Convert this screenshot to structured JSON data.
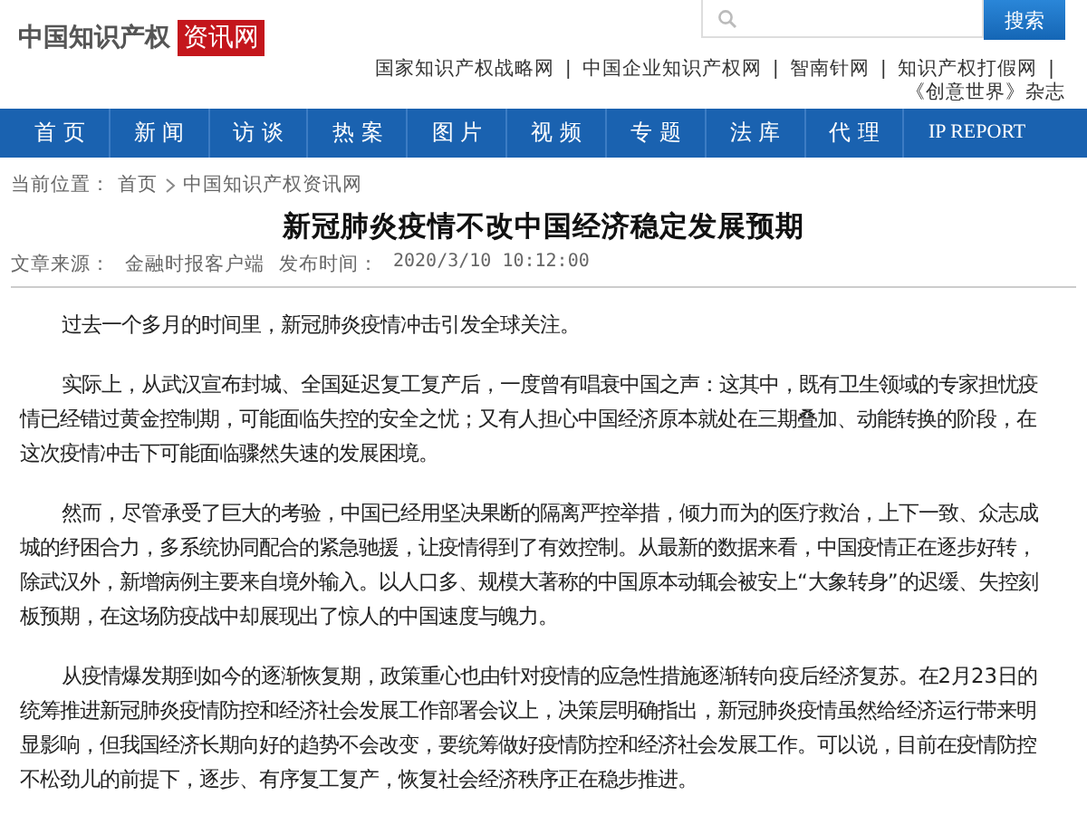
{
  "logo": {
    "name": "中国知识产权",
    "badge": "资讯网"
  },
  "search": {
    "button": "搜索"
  },
  "links": [
    {
      "label": "国家知识产权战略网",
      "separator": "|"
    },
    {
      "label": "中国企业知识产权网",
      "separator": "|"
    },
    {
      "label": "智南针网",
      "separator": "|"
    },
    {
      "label": "知识产权打假网",
      "separator": "|"
    },
    {
      "label": "《创意世界》杂志"
    }
  ],
  "nav": [
    "首 页",
    "新 闻",
    "访 谈",
    "热 案",
    "图 片",
    "视 频",
    "专 题",
    "法 库",
    "代 理",
    "IP REPORT"
  ],
  "breadcrumb": {
    "label": "当前位置：",
    "items": [
      "首页",
      "中国知识产权资讯网"
    ]
  },
  "article": {
    "title": "新冠肺炎疫情不改中国经济稳定发展预期",
    "source_label": "文章来源：",
    "source": "金融时报客户端",
    "time_label": "发布时间：",
    "time": "2020/3/10 10:12:00",
    "paragraphs": [
      "过去一个多月的时间里，新冠肺炎疫情冲击引发全球关注。",
      "实际上，从武汉宣布封城、全国延迟复工复产后，一度曾有唱衰中国之声：这其中，既有卫生领域的专家担忧疫情已经错过黄金控制期，可能面临失控的安全之忧；又有人担心中国经济原本就处在三期叠加、动能转换的阶段，在这次疫情冲击下可能面临骤然失速的发展困境。",
      "然而，尽管承受了巨大的考验，中国已经用坚决果断的隔离严控举措，倾力而为的医疗救治，上下一致、众志成城的纾困合力，多系统协同配合的紧急驰援，让疫情得到了有效控制。从最新的数据来看，中国疫情正在逐步好转，除武汉外，新增病例主要来自境外输入。以人口多、规模大著称的中国原本动辄会被安上“大象转身”的迟缓、失控刻板预期，在这场防疫战中却展现出了惊人的中国速度与魄力。",
      "从疫情爆发期到如今的逐渐恢复期，政策重心也由针对疫情的应急性措施逐渐转向疫后经济复苏。在2月23日的统筹推进新冠肺炎疫情防控和经济社会发展工作部署会议上，决策层明确指出，新冠肺炎疫情虽然给经济运行带来明显影响，但我国经济长期向好的趋势不会改变，要统筹做好疫情防控和经济社会发展工作。可以说，目前在疫情防控不松劲儿的前提下，逐步、有序复工复产，恢复社会经济秩序正在稳步推进。"
    ]
  }
}
